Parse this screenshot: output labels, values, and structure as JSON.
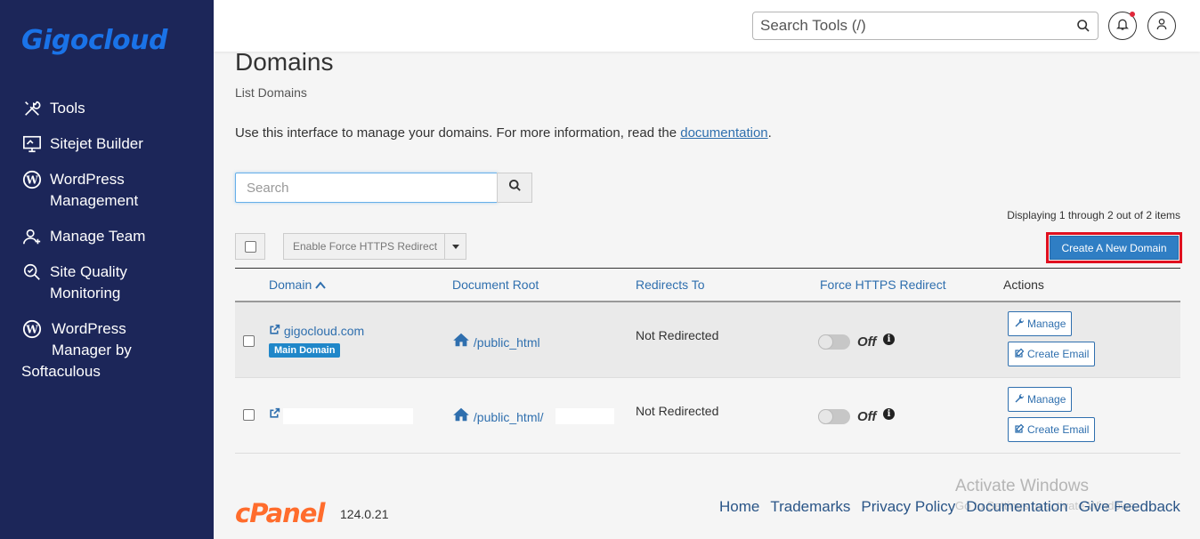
{
  "sidebar": {
    "logo": "Gigocloud",
    "items": [
      {
        "label": "Tools",
        "icon": "tools-icon"
      },
      {
        "label": "Sitejet Builder",
        "icon": "monitor-icon"
      },
      {
        "label": "WordPress",
        "label2": "Management",
        "icon": "wordpress-icon"
      },
      {
        "label": "Manage Team",
        "icon": "user-plus-icon"
      },
      {
        "label": "Site Quality",
        "label2": "Monitoring",
        "icon": "magnifier-check-icon"
      },
      {
        "label": "WordPress",
        "label2": "Manager by",
        "label3": "Softaculous",
        "icon": "wordpress-icon"
      }
    ]
  },
  "topbar": {
    "search_placeholder": "Search Tools (/)"
  },
  "page": {
    "title": "Domains",
    "subtitle": "List Domains",
    "intro_text": "Use this interface to manage your domains. For more information, read the ",
    "intro_link": "documentation",
    "intro_end": ".",
    "search_placeholder": "Search",
    "displaying": "Displaying 1 through 2 out of 2 items",
    "force_https_label": "Enable Force HTTPS Redirect",
    "create_label": "Create A New Domain"
  },
  "table": {
    "headers": {
      "domain": "Domain",
      "docroot": "Document Root",
      "redirects": "Redirects To",
      "https": "Force HTTPS Redirect",
      "actions": "Actions"
    },
    "rows": [
      {
        "domain": "gigocloud.com",
        "badge": "Main Domain",
        "docroot": "/public_html",
        "redirect": "Not Redirected",
        "https": "Off",
        "manage": "Manage",
        "create_email": "Create Email"
      },
      {
        "domain": "",
        "docroot": "/public_html/",
        "redirect": "Not Redirected",
        "https": "Off",
        "manage": "Manage",
        "create_email": "Create Email"
      }
    ]
  },
  "footer": {
    "logo": "cPanel",
    "version": "124.0.21",
    "links": [
      "Home",
      "Trademarks",
      "Privacy Policy",
      "Documentation",
      "Give Feedback"
    ]
  },
  "watermark": {
    "line1": "Activate Windows",
    "line2": "Go to Settings to activate Windows."
  },
  "colors": {
    "sidebar_bg": "#1c2659",
    "accent": "#2f7ec4",
    "highlight": "#e0101f",
    "cpanel_orange": "#ff6c2c"
  }
}
